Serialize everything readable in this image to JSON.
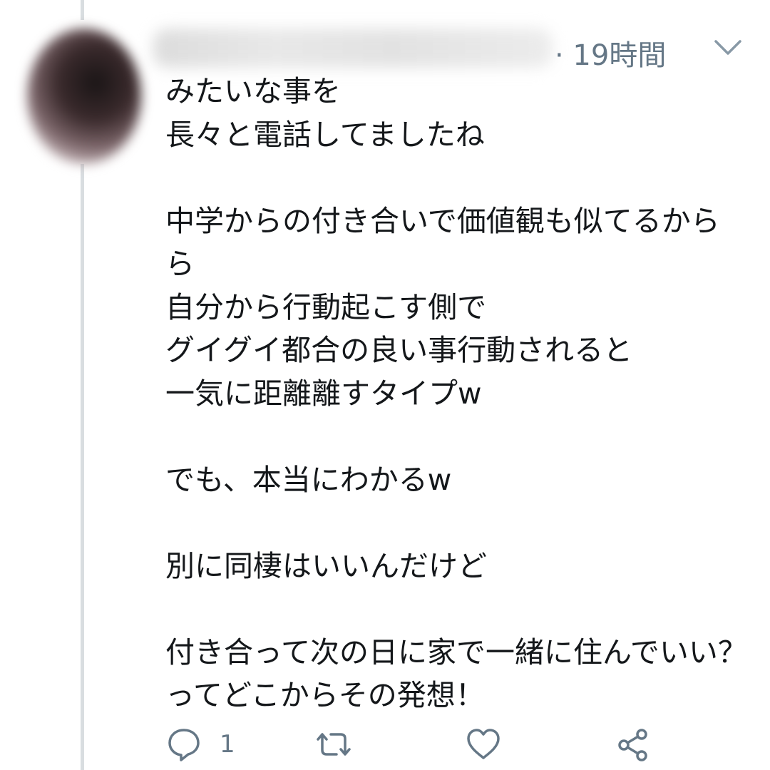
{
  "tweet": {
    "timestamp": "· 19時間",
    "text": "みたいな事を\n長々と電話してましたね\n\n中学からの付き合いで価値観も似てるから\nら\n自分から行動起こす側で\nグイグイ都合の良い事行動されると\n一気に距離離すタイプw\n\nでも、本当にわかるw\n\n別に同棲はいいんだけど\n\n付き合って次の日に家で一緒に住んでいい？ってどこからその発想！",
    "reply_count": "1"
  },
  "icons": {
    "menu": "chevron-down-icon",
    "reply": "reply-icon",
    "retweet": "retweet-icon",
    "like": "heart-icon",
    "share": "share-icon"
  },
  "colors": {
    "text": "#14171a",
    "secondary": "#657786",
    "thread_line": "#d9dde0"
  }
}
